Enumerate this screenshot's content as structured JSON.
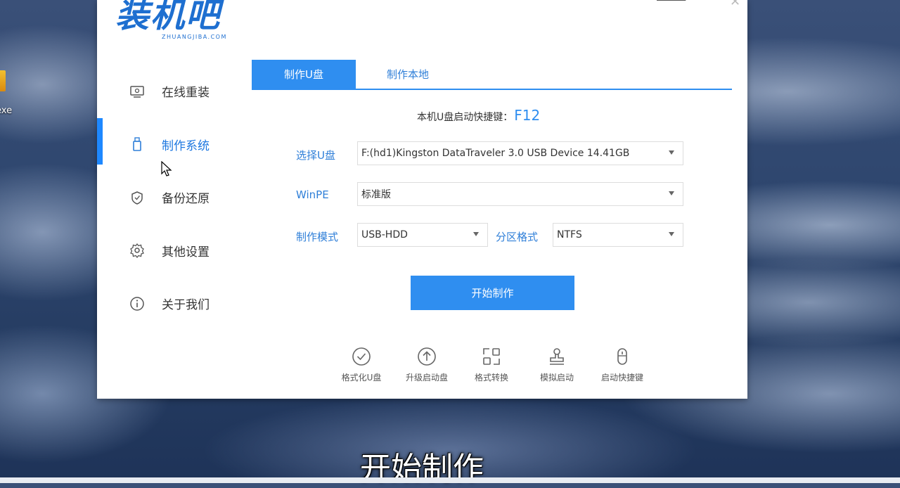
{
  "desktop": {
    "icon_label": "exe"
  },
  "logo": {
    "main": "装机吧",
    "sub": "ZHUANGJIBA.COM"
  },
  "sidebar": {
    "items": [
      {
        "label": "在线重装",
        "icon": "monitor-icon"
      },
      {
        "label": "制作系统",
        "icon": "usb-icon",
        "active": true
      },
      {
        "label": "备份还原",
        "icon": "backup-icon"
      },
      {
        "label": "其他设置",
        "icon": "gear-icon"
      },
      {
        "label": "关于我们",
        "icon": "info-icon"
      }
    ]
  },
  "tabs": [
    {
      "label": "制作U盘",
      "active": true
    },
    {
      "label": "制作本地",
      "active": false
    }
  ],
  "hotkey": {
    "label": "本机U盘启动快捷键：",
    "key": "F12"
  },
  "form": {
    "usb_label": "选择U盘",
    "usb_value": "F:(hd1)Kingston DataTraveler 3.0 USB Device 14.41GB",
    "winpe_label": "WinPE",
    "winpe_value": "标准版",
    "mode_label": "制作模式",
    "mode_value": "USB-HDD",
    "partition_label": "分区格式",
    "partition_value": "NTFS"
  },
  "start_button": "开始制作",
  "tools": [
    {
      "label": "格式化U盘",
      "icon": "check-circle-icon"
    },
    {
      "label": "升级启动盘",
      "icon": "upload-circle-icon"
    },
    {
      "label": "格式转换",
      "icon": "convert-icon"
    },
    {
      "label": "模拟启动",
      "icon": "stamp-icon"
    },
    {
      "label": "启动快捷键",
      "icon": "mouse-icon"
    }
  ],
  "subtitle": "开始制作",
  "colors": {
    "accent": "#2f8ef0",
    "label_blue": "#2f7fd8"
  }
}
